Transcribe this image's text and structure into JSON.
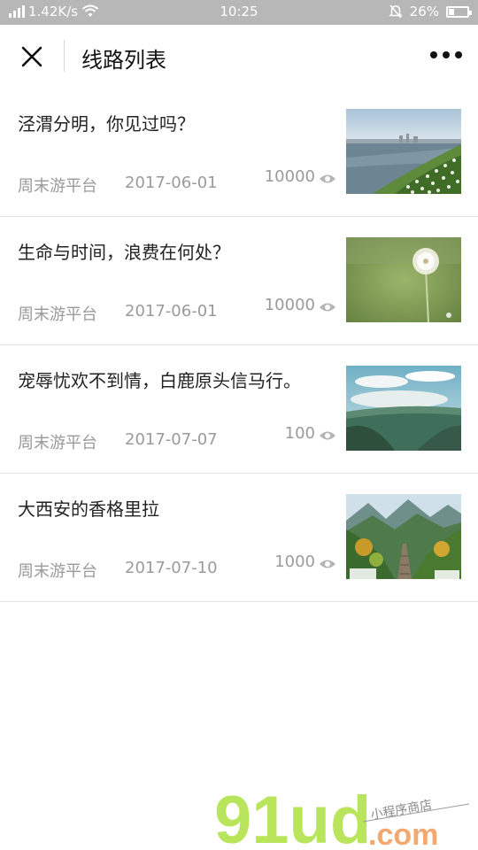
{
  "status_bar": {
    "speed": "1.42K/s",
    "time": "10:25",
    "battery": "26%",
    "battery_level": 0.26
  },
  "nav": {
    "title": "线路列表"
  },
  "items": [
    {
      "title": "泾渭分明，你见过吗？",
      "source": "周末游平台",
      "date": "2017-06-01",
      "views": "10000",
      "thumb": "river-landscape"
    },
    {
      "title": "生命与时间，浪费在何处？",
      "source": "周末游平台",
      "date": "2017-06-01",
      "views": "10000",
      "thumb": "dandelion"
    },
    {
      "title": "宠辱忧欢不到情，白鹿原头信马行。",
      "source": "周末游平台",
      "date": "2017-07-07",
      "views": "100",
      "thumb": "plateau-clouds"
    },
    {
      "title": "大西安的香格里拉",
      "source": "周末游平台",
      "date": "2017-07-10",
      "views": "1000",
      "thumb": "mountain-valley"
    }
  ],
  "watermark": {
    "logo": "91ud",
    "domain": ".com",
    "slogan": "小程序商店"
  }
}
